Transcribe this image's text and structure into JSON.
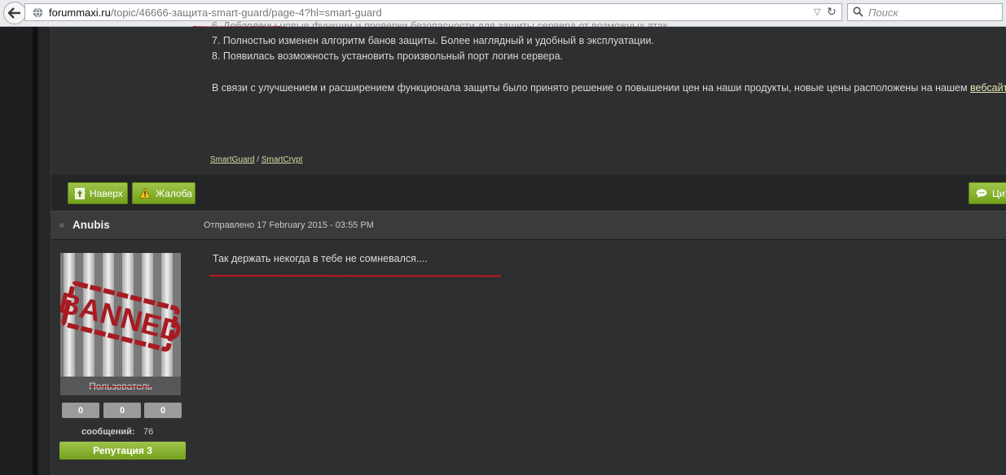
{
  "browser": {
    "url_host": "forummaxi.ru",
    "url_path_1": "/topic/46666-",
    "url_path_slug": "защита-smart-guard",
    "url_path_2": "/page-4?hl=smart-guard",
    "search_placeholder": "Поиск"
  },
  "previous_post": {
    "line7": "7. Полностью изменен алгоритм банов защиты. Более наглядный и удобный в эксплуатации.",
    "line8": "8. Появилась возможность установить произвольный порт логин сервера.",
    "para": "В связи с улучшением и расширением функционала защиты было принято решение о повышении цен на наши продукты, новые цены расположены на нашем",
    "para_link": "вебсайте",
    "para_end": ".",
    "sig_link_1": "SmartGuard",
    "sig_sep": " / ",
    "sig_link_2": "SmartCrypt"
  },
  "buttons": {
    "top": "Наверх",
    "report": "Жалоба",
    "quote_partial": "Цит"
  },
  "post": {
    "author": "Anubis",
    "posted": "Отправлено 17 February 2015 - 03:55 PM",
    "text": "Так держать некогда в тебе не сомневался....",
    "avatar_stamp": "BANNED",
    "user_group": "Пользователь",
    "stats": [
      "0",
      "0",
      "0"
    ],
    "messages_label": "сообщений:",
    "messages_count": "76",
    "reputation": "Репутация 3"
  },
  "colors": {
    "accent_green": "#8ab536",
    "annotation_red": "#c0171a",
    "link_yellow": "#e7e7b5"
  }
}
